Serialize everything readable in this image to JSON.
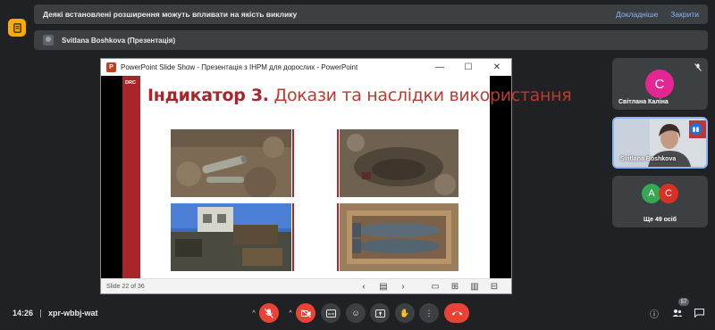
{
  "extension_banner": {
    "message": "Деякі встановлені розширення можуть впливати на якість виклику",
    "details_link": "Докладніше",
    "close_link": "Закрити"
  },
  "presenter": {
    "label": "Svitlana Boshkova (Презентація)"
  },
  "powerpoint": {
    "logo_letter": "P",
    "window_title": "PowerPoint Slide Show  -  Презентація з ІНРМ для дорослих  -  PowerPoint",
    "slide": {
      "brand": "DRC",
      "title_bold": "Індикатор 3.",
      "title_rest": " Докази та наслідки використання"
    },
    "status": {
      "slide_number": "Slide 22 of 36"
    }
  },
  "participants": [
    {
      "name": "Світлана Каліна",
      "initial": "С",
      "color": "#e52592",
      "muted": true
    },
    {
      "name": "Svitlana Boshkova",
      "speaking": true
    },
    {
      "more_label": "Ще 49 осіб",
      "avatars": [
        {
          "initial": "А",
          "color": "#34a853"
        },
        {
          "initial": "С",
          "color": "#d93025"
        }
      ]
    }
  ],
  "bottom_bar": {
    "time": "14:26",
    "meeting_code": "xpr-wbbj-wat",
    "participants_count": "57"
  },
  "colors": {
    "accent_red": "#ea4335",
    "slide_red": "#a8262a",
    "banner_bg": "#3c4043",
    "page_bg": "#202124",
    "link": "#8ab4f8"
  }
}
